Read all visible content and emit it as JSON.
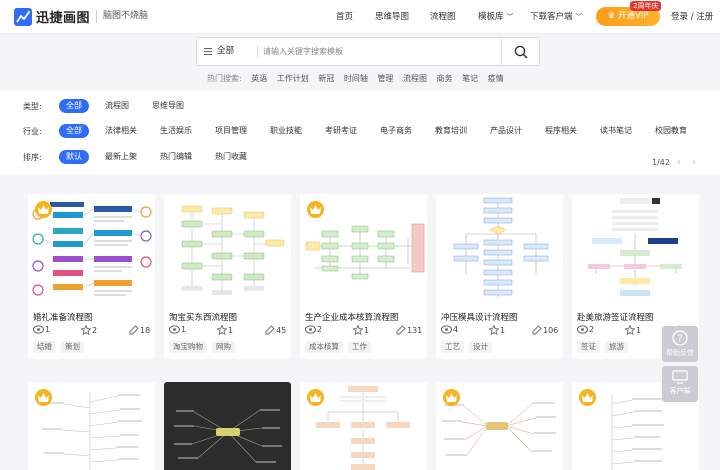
{
  "brand": {
    "name": "迅捷画图",
    "slogan": "脑图不烧脑"
  },
  "nav": [
    {
      "label": "首页"
    },
    {
      "label": "思维导图"
    },
    {
      "label": "流程图"
    },
    {
      "label": "模板库"
    },
    {
      "label": "下载客户端"
    }
  ],
  "vip": {
    "label": "开通VIP",
    "badge": "2周年庆"
  },
  "login_label": "登录 / 注册",
  "search": {
    "category": "全部",
    "placeholder": "请输入关键字搜索模板"
  },
  "hot_search": {
    "label": "热门搜索:",
    "keywords": [
      "英语",
      "工作计划",
      "新冠",
      "时间轴",
      "管理",
      "流程图",
      "商务",
      "笔记",
      "疫情"
    ]
  },
  "filters": {
    "type": {
      "label": "类型:",
      "options": [
        "全部",
        "流程图",
        "思维导图"
      ]
    },
    "industry": {
      "label": "行业:",
      "options": [
        "全部",
        "法律相关",
        "生活娱乐",
        "项目管理",
        "职业技能",
        "考研考证",
        "电子商务",
        "教育培训",
        "产品设计",
        "程序相关",
        "读书笔记",
        "校园教育"
      ]
    },
    "sort": {
      "label": "排序:",
      "options": [
        "默认",
        "最新上架",
        "热门编辑",
        "热门收藏"
      ]
    }
  },
  "pagination": {
    "text": "1/42"
  },
  "cards": [
    {
      "title": "婚礼准备流程图",
      "views": "1",
      "likes": "2",
      "edits": "18",
      "tags": [
        "结婚",
        "策划"
      ]
    },
    {
      "title": "淘宝买东西流程图",
      "views": "1",
      "likes": "1",
      "edits": "45",
      "tags": [
        "淘宝购物",
        "网购"
      ]
    },
    {
      "title": "生产企业成本核算流程图",
      "views": "2",
      "likes": "1",
      "edits": "131",
      "tags": [
        "成本核算",
        "工作"
      ]
    },
    {
      "title": "冲压模具设计流程图",
      "views": "4",
      "likes": "1",
      "edits": "106",
      "tags": [
        "工艺",
        "设计"
      ]
    },
    {
      "title": "赴美旅游签证流程图",
      "views": "2",
      "likes": "1",
      "edits": "1",
      "tags": [
        "签证",
        "旅游"
      ]
    }
  ],
  "side_tools": [
    {
      "label": "帮助反馈"
    },
    {
      "label": "客户端"
    }
  ],
  "colors": {
    "accent": "#2f6df6",
    "vip": "#ffa21f",
    "crown": "#f6b51e",
    "badge": "#e8352b"
  }
}
